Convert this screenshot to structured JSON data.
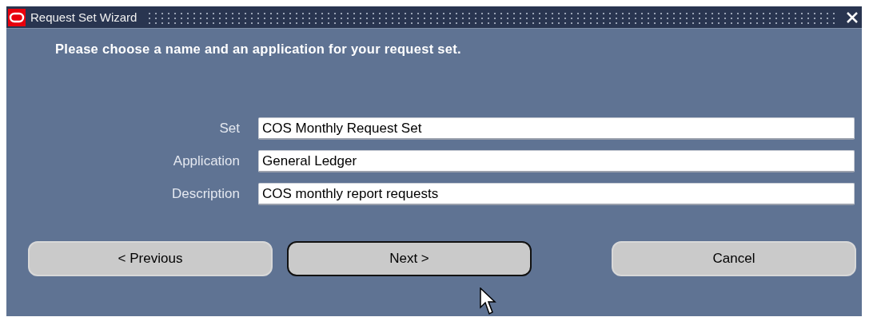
{
  "window": {
    "title": "Request Set Wizard"
  },
  "instruction": "Please choose a name and an application for your request set.",
  "fields": [
    {
      "label": "Set",
      "value": "COS Monthly Request Set"
    },
    {
      "label": "Application",
      "value": "General Ledger"
    },
    {
      "label": "Description",
      "value": "COS monthly report requests"
    }
  ],
  "buttons": [
    {
      "label": "< Previous",
      "focused": false
    },
    {
      "label": "Next >",
      "focused": true
    },
    {
      "label": "Cancel",
      "focused": false
    }
  ]
}
